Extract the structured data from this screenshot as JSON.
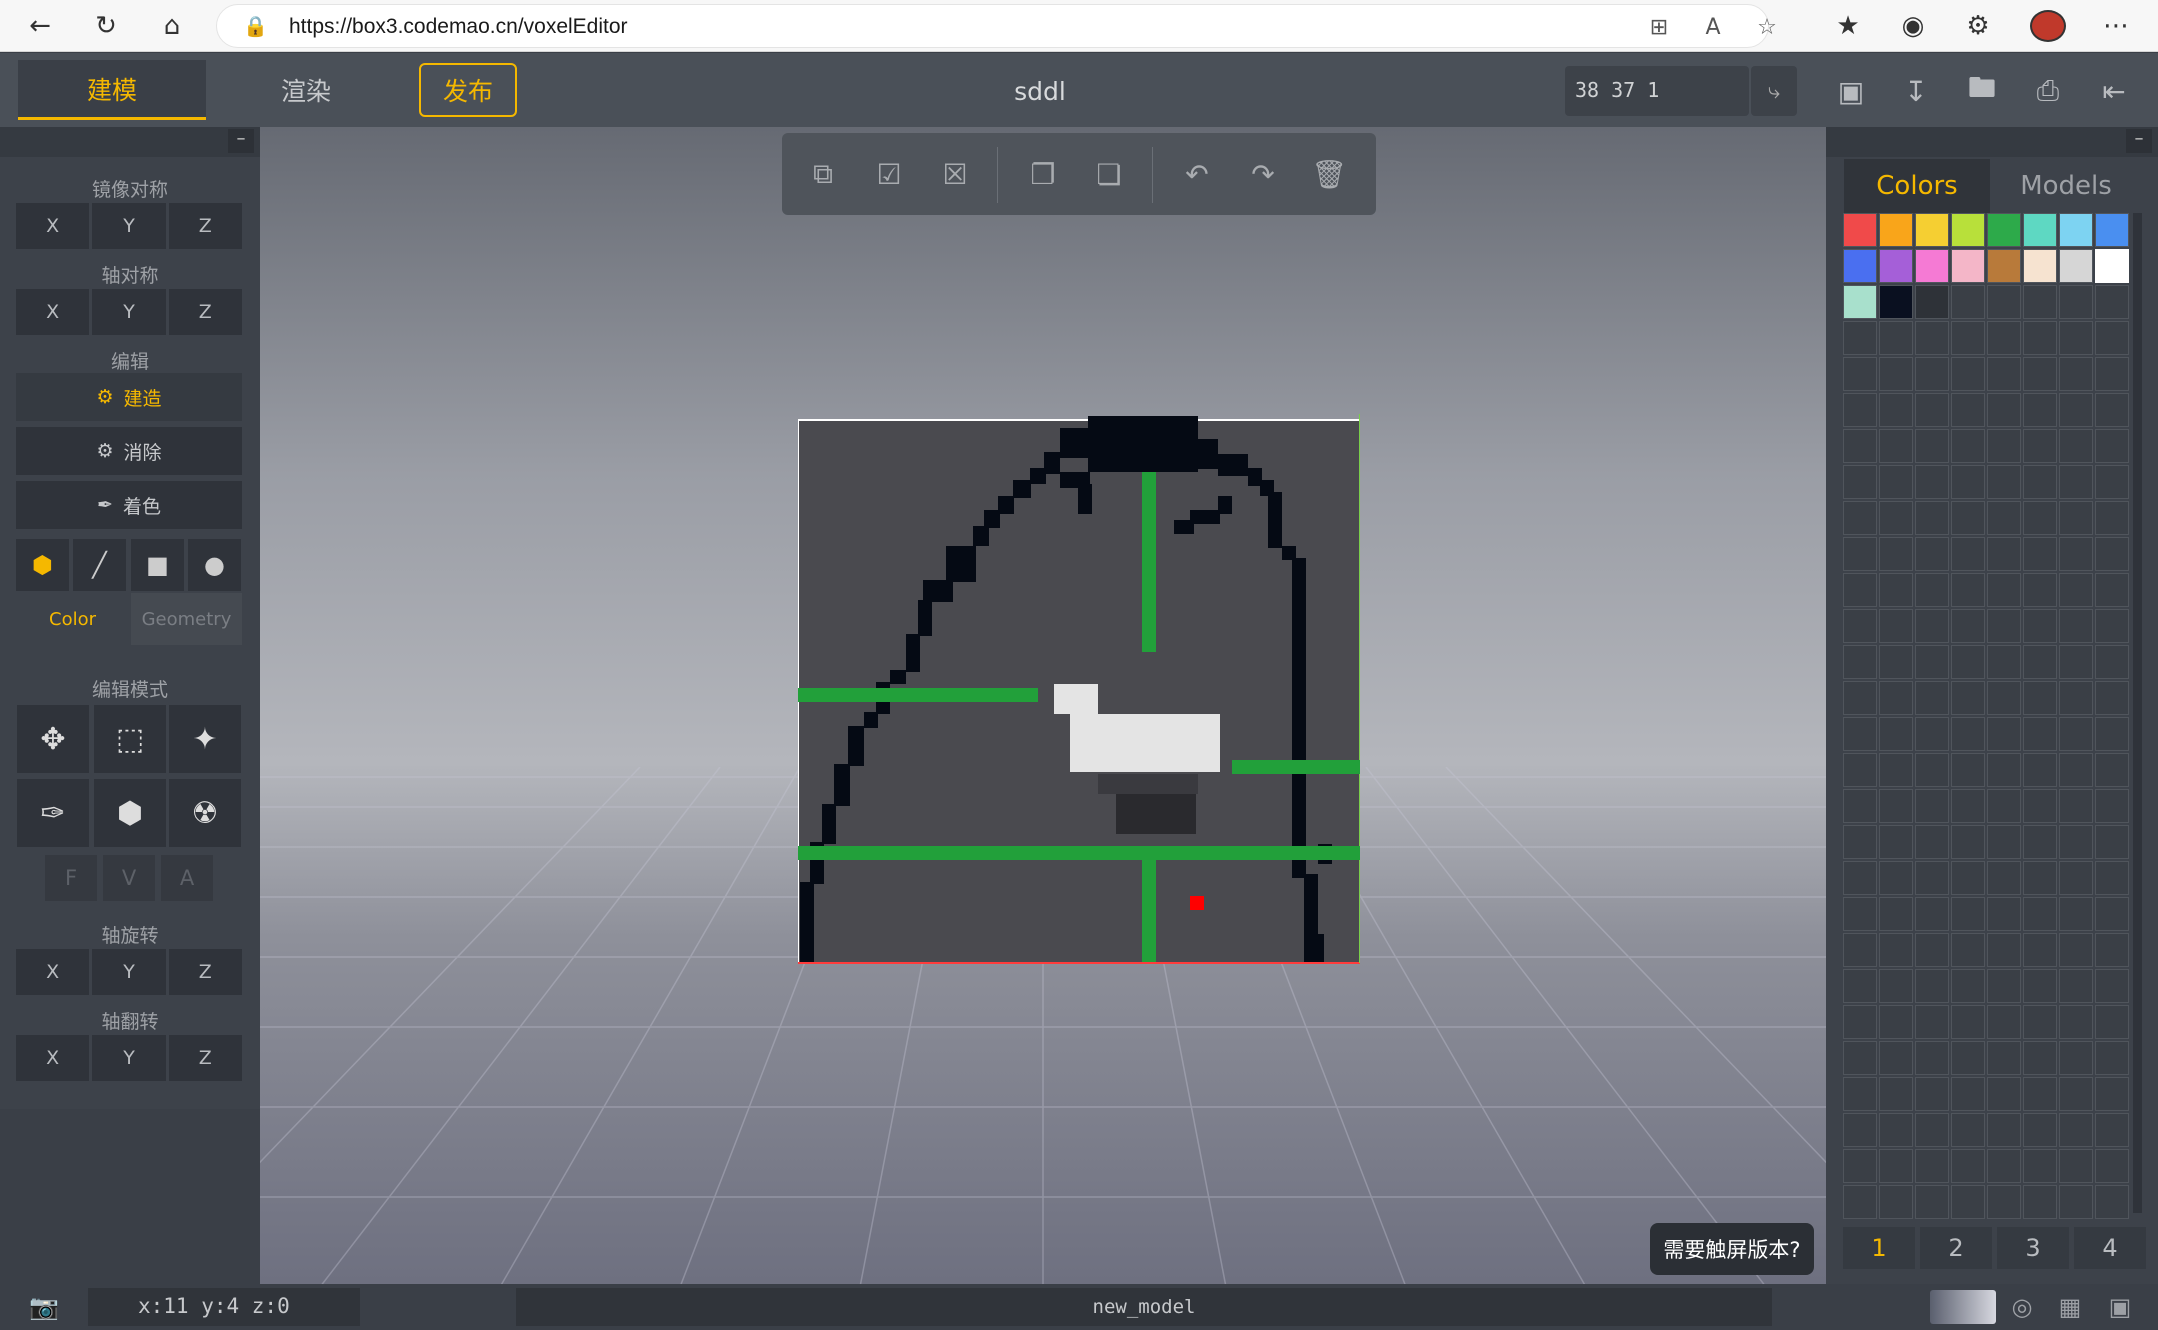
{
  "browser": {
    "url": "https://box3.codemao.cn/voxelEditor"
  },
  "topbar": {
    "tab_model": "建模",
    "tab_render": "渲染",
    "tab_publish": "发布",
    "project_title": "sddl",
    "coords": "38 37 1"
  },
  "left_panel": {
    "mirror_label": "镜像对称",
    "axis_sym_label": "轴对称",
    "edit_label": "编辑",
    "build_label": "建造",
    "erase_label": "消除",
    "paint_label": "着色",
    "color_tab": "Color",
    "geometry_tab": "Geometry",
    "edit_mode_label": "编辑模式",
    "fva": [
      "F",
      "V",
      "A"
    ],
    "axis_rotate_label": "轴旋转",
    "axis_flip_label": "轴翻转",
    "xyz": [
      "X",
      "Y",
      "Z"
    ]
  },
  "right_panel": {
    "tab_colors": "Colors",
    "tab_models": "Models",
    "palette": [
      "#f04a4a",
      "#f9a51a",
      "#f5cf32",
      "#b8e03a",
      "#2daa4a",
      "#5ed8c2",
      "#7dd3f2",
      "#4a8ff0",
      "#4a6ff0",
      "#a55fd8",
      "#f57ad4",
      "#f4b6c8",
      "#b87a3a",
      "#f6e3d0",
      "#d6d6d6",
      "#ffffff",
      "#a8e0cc",
      "#0a1020",
      "#2e3238"
    ],
    "pages": [
      "1",
      "2",
      "3",
      "4"
    ]
  },
  "bottom": {
    "position": "x:11 y:4 z:0",
    "model_name": "new_model",
    "touch_prompt": "需要触屏版本?"
  },
  "colors": {
    "accent": "#f5b800",
    "voxel_dark": "#050a14",
    "voxel_green": "#22a03a",
    "voxel_white": "#e4e4e4",
    "voxel_gray": "#555555",
    "voxel_red": "#ff0000"
  }
}
